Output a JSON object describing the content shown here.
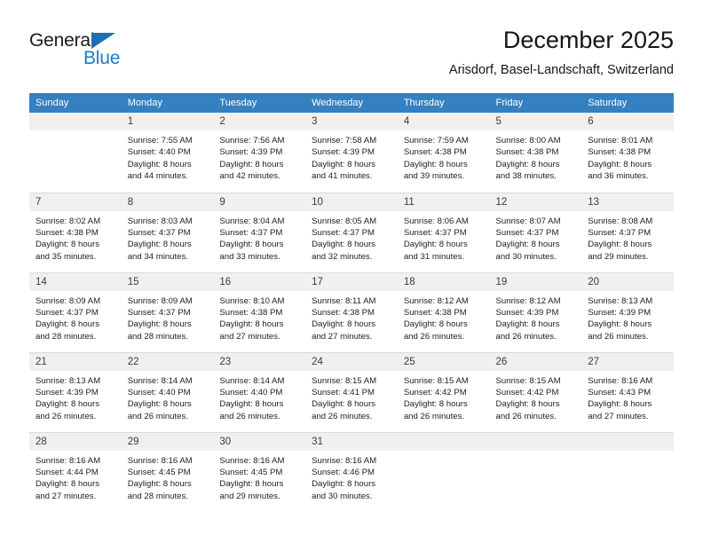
{
  "brand": {
    "name_primary": "General",
    "name_secondary": "Blue"
  },
  "header": {
    "title": "December 2025",
    "subtitle": "Arisdorf, Basel-Landschaft, Switzerland"
  },
  "colors": {
    "header_row": "#3580c0",
    "day_number_band": "#f0f0f0",
    "brand_blue": "#1f7ac4",
    "text": "#222222"
  },
  "weekday_headers": [
    "Sunday",
    "Monday",
    "Tuesday",
    "Wednesday",
    "Thursday",
    "Friday",
    "Saturday"
  ],
  "weeks": [
    [
      {
        "day": "",
        "empty": true
      },
      {
        "day": "1",
        "sunrise": "Sunrise: 7:55 AM",
        "sunset": "Sunset: 4:40 PM",
        "daylight1": "Daylight: 8 hours",
        "daylight2": "and 44 minutes."
      },
      {
        "day": "2",
        "sunrise": "Sunrise: 7:56 AM",
        "sunset": "Sunset: 4:39 PM",
        "daylight1": "Daylight: 8 hours",
        "daylight2": "and 42 minutes."
      },
      {
        "day": "3",
        "sunrise": "Sunrise: 7:58 AM",
        "sunset": "Sunset: 4:39 PM",
        "daylight1": "Daylight: 8 hours",
        "daylight2": "and 41 minutes."
      },
      {
        "day": "4",
        "sunrise": "Sunrise: 7:59 AM",
        "sunset": "Sunset: 4:38 PM",
        "daylight1": "Daylight: 8 hours",
        "daylight2": "and 39 minutes."
      },
      {
        "day": "5",
        "sunrise": "Sunrise: 8:00 AM",
        "sunset": "Sunset: 4:38 PM",
        "daylight1": "Daylight: 8 hours",
        "daylight2": "and 38 minutes."
      },
      {
        "day": "6",
        "sunrise": "Sunrise: 8:01 AM",
        "sunset": "Sunset: 4:38 PM",
        "daylight1": "Daylight: 8 hours",
        "daylight2": "and 36 minutes."
      }
    ],
    [
      {
        "day": "7",
        "sunrise": "Sunrise: 8:02 AM",
        "sunset": "Sunset: 4:38 PM",
        "daylight1": "Daylight: 8 hours",
        "daylight2": "and 35 minutes."
      },
      {
        "day": "8",
        "sunrise": "Sunrise: 8:03 AM",
        "sunset": "Sunset: 4:37 PM",
        "daylight1": "Daylight: 8 hours",
        "daylight2": "and 34 minutes."
      },
      {
        "day": "9",
        "sunrise": "Sunrise: 8:04 AM",
        "sunset": "Sunset: 4:37 PM",
        "daylight1": "Daylight: 8 hours",
        "daylight2": "and 33 minutes."
      },
      {
        "day": "10",
        "sunrise": "Sunrise: 8:05 AM",
        "sunset": "Sunset: 4:37 PM",
        "daylight1": "Daylight: 8 hours",
        "daylight2": "and 32 minutes."
      },
      {
        "day": "11",
        "sunrise": "Sunrise: 8:06 AM",
        "sunset": "Sunset: 4:37 PM",
        "daylight1": "Daylight: 8 hours",
        "daylight2": "and 31 minutes."
      },
      {
        "day": "12",
        "sunrise": "Sunrise: 8:07 AM",
        "sunset": "Sunset: 4:37 PM",
        "daylight1": "Daylight: 8 hours",
        "daylight2": "and 30 minutes."
      },
      {
        "day": "13",
        "sunrise": "Sunrise: 8:08 AM",
        "sunset": "Sunset: 4:37 PM",
        "daylight1": "Daylight: 8 hours",
        "daylight2": "and 29 minutes."
      }
    ],
    [
      {
        "day": "14",
        "sunrise": "Sunrise: 8:09 AM",
        "sunset": "Sunset: 4:37 PM",
        "daylight1": "Daylight: 8 hours",
        "daylight2": "and 28 minutes."
      },
      {
        "day": "15",
        "sunrise": "Sunrise: 8:09 AM",
        "sunset": "Sunset: 4:37 PM",
        "daylight1": "Daylight: 8 hours",
        "daylight2": "and 28 minutes."
      },
      {
        "day": "16",
        "sunrise": "Sunrise: 8:10 AM",
        "sunset": "Sunset: 4:38 PM",
        "daylight1": "Daylight: 8 hours",
        "daylight2": "and 27 minutes."
      },
      {
        "day": "17",
        "sunrise": "Sunrise: 8:11 AM",
        "sunset": "Sunset: 4:38 PM",
        "daylight1": "Daylight: 8 hours",
        "daylight2": "and 27 minutes."
      },
      {
        "day": "18",
        "sunrise": "Sunrise: 8:12 AM",
        "sunset": "Sunset: 4:38 PM",
        "daylight1": "Daylight: 8 hours",
        "daylight2": "and 26 minutes."
      },
      {
        "day": "19",
        "sunrise": "Sunrise: 8:12 AM",
        "sunset": "Sunset: 4:39 PM",
        "daylight1": "Daylight: 8 hours",
        "daylight2": "and 26 minutes."
      },
      {
        "day": "20",
        "sunrise": "Sunrise: 8:13 AM",
        "sunset": "Sunset: 4:39 PM",
        "daylight1": "Daylight: 8 hours",
        "daylight2": "and 26 minutes."
      }
    ],
    [
      {
        "day": "21",
        "sunrise": "Sunrise: 8:13 AM",
        "sunset": "Sunset: 4:39 PM",
        "daylight1": "Daylight: 8 hours",
        "daylight2": "and 26 minutes."
      },
      {
        "day": "22",
        "sunrise": "Sunrise: 8:14 AM",
        "sunset": "Sunset: 4:40 PM",
        "daylight1": "Daylight: 8 hours",
        "daylight2": "and 26 minutes."
      },
      {
        "day": "23",
        "sunrise": "Sunrise: 8:14 AM",
        "sunset": "Sunset: 4:40 PM",
        "daylight1": "Daylight: 8 hours",
        "daylight2": "and 26 minutes."
      },
      {
        "day": "24",
        "sunrise": "Sunrise: 8:15 AM",
        "sunset": "Sunset: 4:41 PM",
        "daylight1": "Daylight: 8 hours",
        "daylight2": "and 26 minutes."
      },
      {
        "day": "25",
        "sunrise": "Sunrise: 8:15 AM",
        "sunset": "Sunset: 4:42 PM",
        "daylight1": "Daylight: 8 hours",
        "daylight2": "and 26 minutes."
      },
      {
        "day": "26",
        "sunrise": "Sunrise: 8:15 AM",
        "sunset": "Sunset: 4:42 PM",
        "daylight1": "Daylight: 8 hours",
        "daylight2": "and 26 minutes."
      },
      {
        "day": "27",
        "sunrise": "Sunrise: 8:16 AM",
        "sunset": "Sunset: 4:43 PM",
        "daylight1": "Daylight: 8 hours",
        "daylight2": "and 27 minutes."
      }
    ],
    [
      {
        "day": "28",
        "sunrise": "Sunrise: 8:16 AM",
        "sunset": "Sunset: 4:44 PM",
        "daylight1": "Daylight: 8 hours",
        "daylight2": "and 27 minutes."
      },
      {
        "day": "29",
        "sunrise": "Sunrise: 8:16 AM",
        "sunset": "Sunset: 4:45 PM",
        "daylight1": "Daylight: 8 hours",
        "daylight2": "and 28 minutes."
      },
      {
        "day": "30",
        "sunrise": "Sunrise: 8:16 AM",
        "sunset": "Sunset: 4:45 PM",
        "daylight1": "Daylight: 8 hours",
        "daylight2": "and 29 minutes."
      },
      {
        "day": "31",
        "sunrise": "Sunrise: 8:16 AM",
        "sunset": "Sunset: 4:46 PM",
        "daylight1": "Daylight: 8 hours",
        "daylight2": "and 30 minutes."
      },
      {
        "day": "",
        "empty": true
      },
      {
        "day": "",
        "empty": true
      },
      {
        "day": "",
        "empty": true
      }
    ]
  ]
}
